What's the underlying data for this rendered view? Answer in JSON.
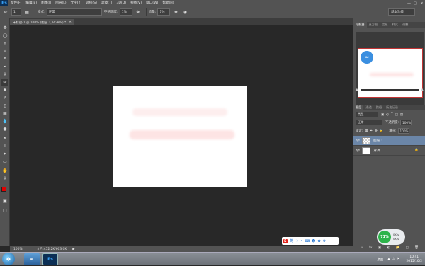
{
  "menubar": {
    "logo": "Ps",
    "items": [
      "文件(F)",
      "编辑(E)",
      "图像(I)",
      "图层(L)",
      "文字(Y)",
      "选择(S)",
      "滤镜(T)",
      "3D(D)",
      "视图(V)",
      "窗口(W)",
      "帮助(H)"
    ]
  },
  "options": {
    "brush_size": "1",
    "mode_label": "模式:",
    "mode_value": "正常",
    "opacity_label": "不透明度:",
    "opacity_value": "1%",
    "flow_label": "流量:",
    "flow_value": "1%",
    "workspace": "基本功能"
  },
  "document_tab": "未标题-1 @ 100% (图层 1, RGB/8) *",
  "status": {
    "zoom": "100%",
    "doc_info": "文档:452.2K/603.0K"
  },
  "panels": {
    "nav_tabs": [
      "导航器",
      "直方图",
      "信息",
      "样式",
      "调整"
    ],
    "layer_tabs": [
      "图层",
      "通道",
      "路径",
      "历史记录"
    ],
    "kind_label": "类型",
    "blend_mode": "正常",
    "opacity_label": "不透明度:",
    "opacity_value": "100%",
    "lock_label": "锁定:",
    "fill_label": "填充:",
    "fill_value": "100%",
    "layers": [
      {
        "name": "图层 1",
        "selected": true
      },
      {
        "name": "背景",
        "selected": false
      }
    ]
  },
  "taskbar": {
    "ps_icon": "Ps",
    "desktop_label": "桌面",
    "time": "10:41",
    "date": "2015/10/2"
  },
  "ime": {
    "lang": "英"
  },
  "speed_widget": {
    "percent": "71%",
    "up": "0K/s",
    "down": "0K/s"
  },
  "colors": {
    "foreground": "#e00000",
    "background": "#ffffff",
    "accent_selected_layer": "#6b86a8"
  }
}
